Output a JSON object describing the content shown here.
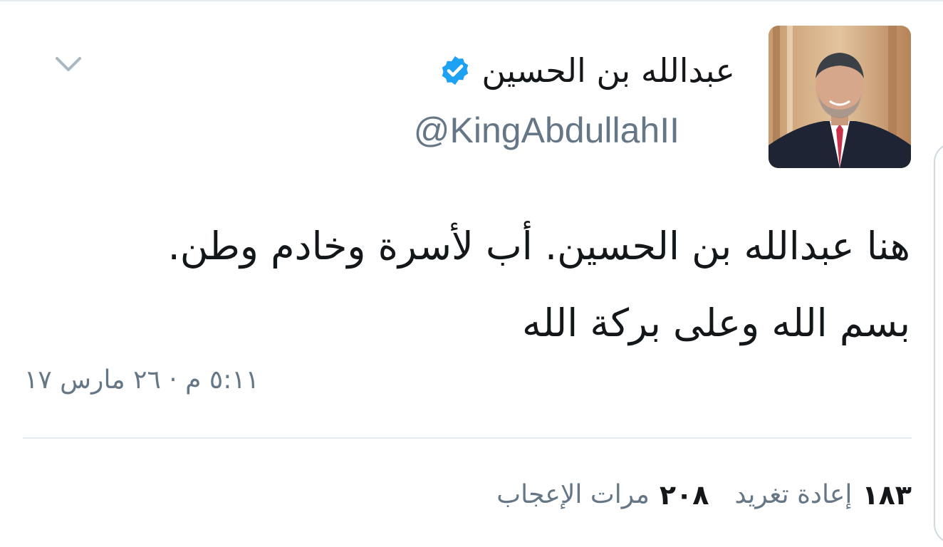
{
  "user": {
    "display_name": "عبدالله بن الحسين",
    "handle": "@KingAbdullahII",
    "avatar_icon": "profile-photo",
    "verified_icon": "verified-badge-icon",
    "verified_color": "#1da1f2"
  },
  "tweet": {
    "text_lines": [
      "هنا عبدالله بن الحسين. أب لأسرة وخادم وطن.",
      "بسم الله وعلى بركة الله"
    ],
    "timestamp": "٥:١١ م · ٢٦ مارس ١٧"
  },
  "stats": {
    "retweets_count": "١٨٣",
    "retweets_label": "إعادة تغريد",
    "likes_count": "٢٠٨",
    "likes_label": "مرات الإعجاب"
  },
  "menu_icon": "chevron-down-icon",
  "colors": {
    "text_primary": "#14171a",
    "text_secondary": "#657786",
    "divider": "#e6ecf0",
    "accent": "#1da1f2"
  }
}
